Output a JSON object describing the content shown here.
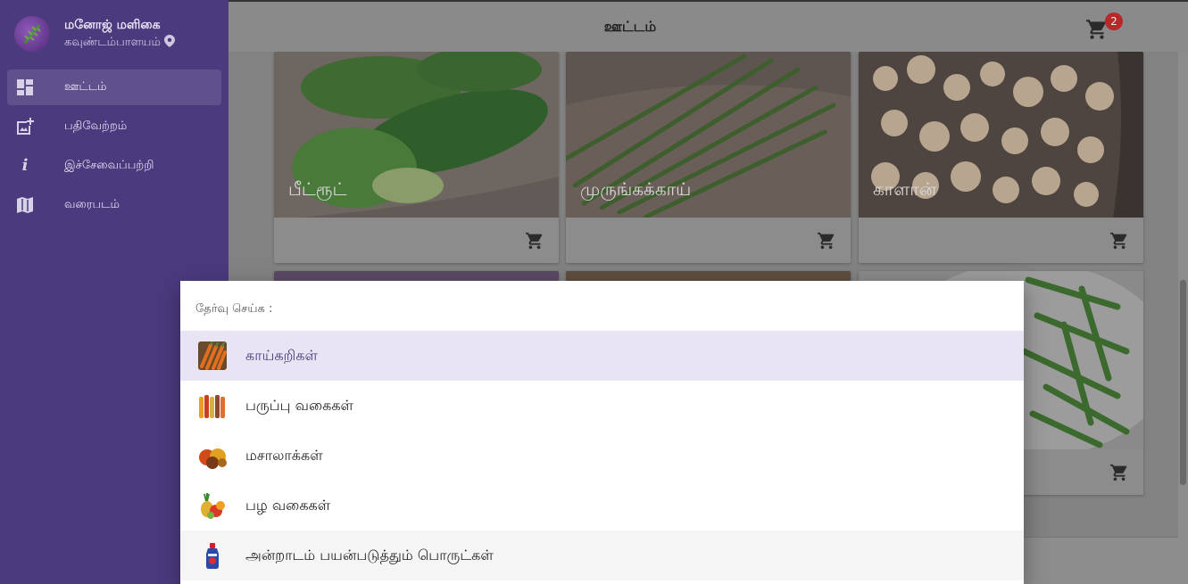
{
  "sidebar": {
    "store_name": "மனோஜ் மளிகை",
    "store_location": "கவுண்டம்பாளயம்",
    "items": [
      {
        "label": "ஊட்டம்",
        "icon": "dashboard-icon",
        "active": true
      },
      {
        "label": "பதிவேற்றம்",
        "icon": "add-photo-icon",
        "active": false
      },
      {
        "label": "இச்சேவைப்பற்றி",
        "icon": "info-icon",
        "active": false
      },
      {
        "label": "வரைபடம்",
        "icon": "map-icon",
        "active": false
      }
    ]
  },
  "header": {
    "title": "ஊட்டம்",
    "cart_count": "2",
    "cart_icon": "shopping-cart-icon"
  },
  "products": [
    {
      "label": "பீட்ரூட்"
    },
    {
      "label": "முருங்கக்காய்"
    },
    {
      "label": "காளான்"
    }
  ],
  "dialog": {
    "title": "தேர்வு செய்க :",
    "options": [
      {
        "label": "காய்கறிகள்",
        "icon": "vegetables-icon",
        "selected": true
      },
      {
        "label": "பருப்பு வகைகள்",
        "icon": "pulses-icon",
        "selected": false
      },
      {
        "label": "மசாலாக்கள்",
        "icon": "spices-icon",
        "selected": false
      },
      {
        "label": "பழ வகைகள்",
        "icon": "fruits-icon",
        "selected": false
      },
      {
        "label": "அன்றாடம் பயன்படுத்தும் பொருட்கள்",
        "icon": "daily-goods-icon",
        "selected": false
      }
    ]
  },
  "colors": {
    "sidebar_bg": "#4b3a7e",
    "accent": "#4b3a7e",
    "badge": "#b8282a",
    "selected_row": "#e8e4f3"
  }
}
